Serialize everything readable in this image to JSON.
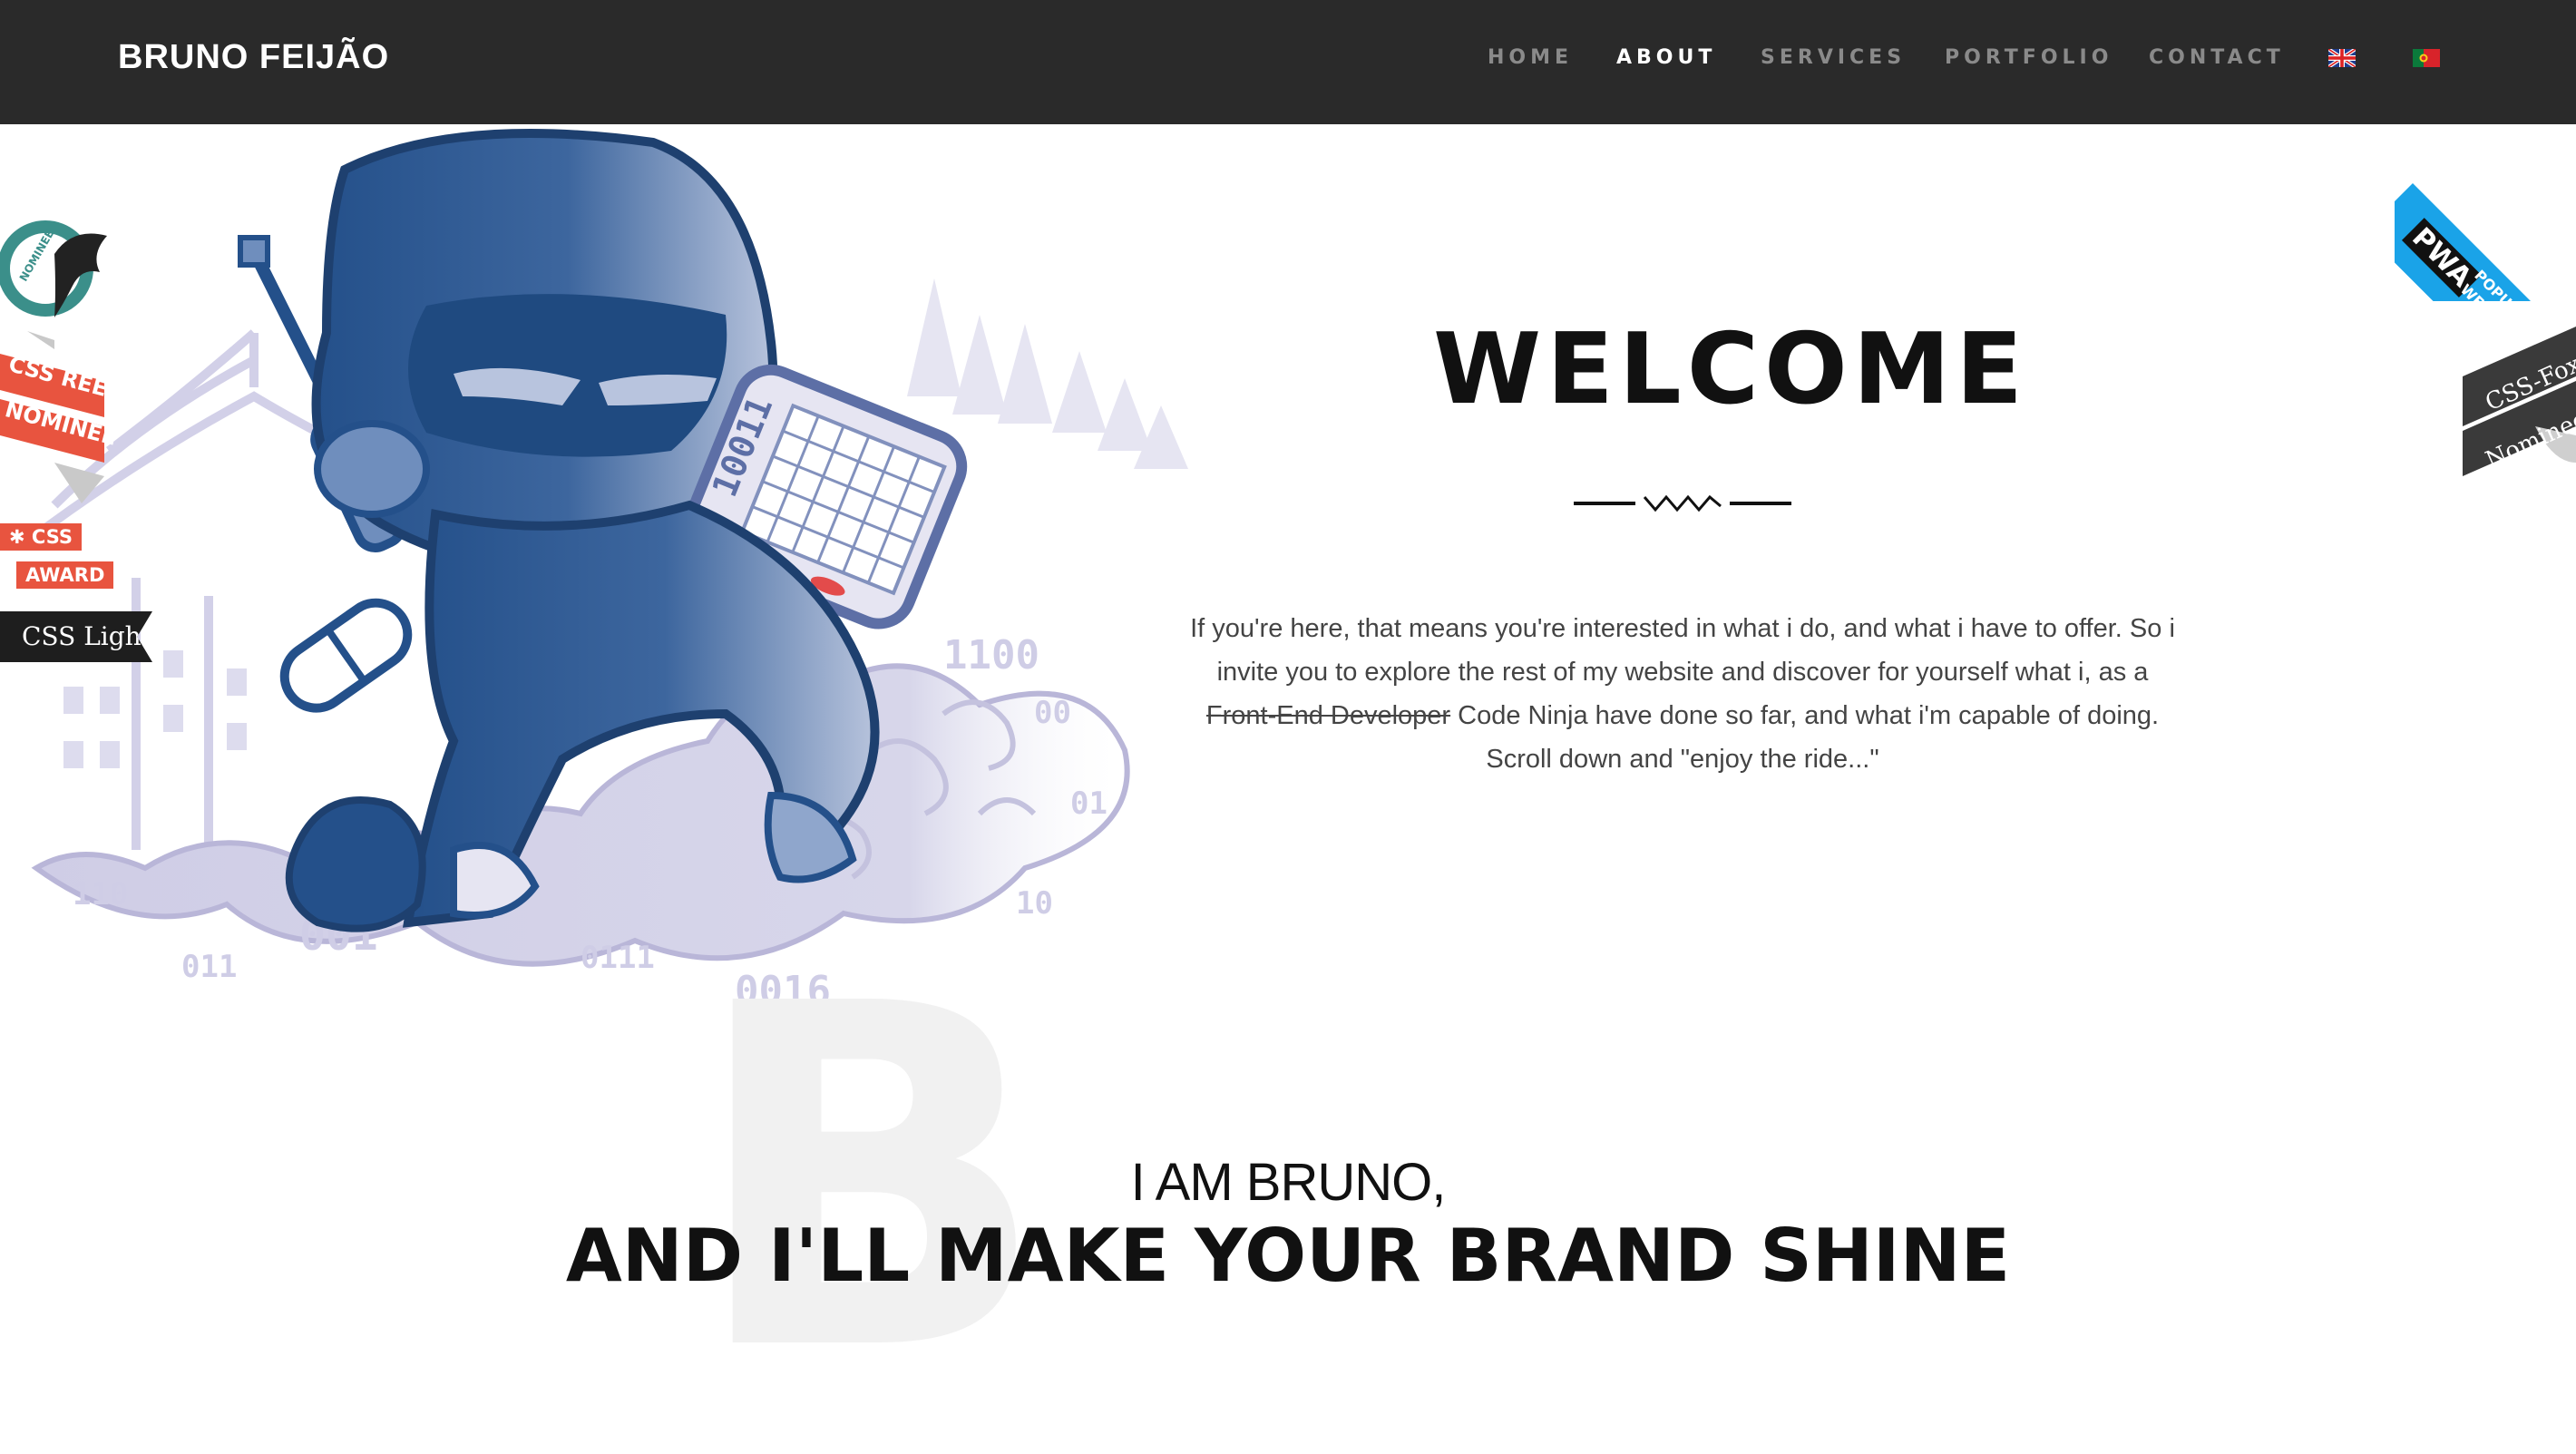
{
  "site": {
    "brand": "BRUNO FEIJÃO"
  },
  "nav": {
    "items": [
      {
        "label": "HOME",
        "active": false
      },
      {
        "label": "ABOUT",
        "active": true
      },
      {
        "label": "SERVICES",
        "active": false
      },
      {
        "label": "PORTFOLIO",
        "active": false
      },
      {
        "label": "CONTACT",
        "active": false
      }
    ],
    "flags": [
      {
        "name": "english-flag-icon"
      },
      {
        "name": "portuguese-flag-icon"
      }
    ]
  },
  "badges": {
    "nominee_label": "NOMINEE",
    "cssreel_line1": "CSS REEL",
    "cssreel_line2": "NOMINEE",
    "cssaward_line1": "CSS",
    "cssaward_line2": "AWARD",
    "csslight": "CSS Light",
    "pwa_short": "PWA",
    "pwa_line1": "POPULAR",
    "pwa_line2": "WEBSITE AWARD",
    "cssfox_line1": "CSS-Fox",
    "cssfox_line2": "Nominee"
  },
  "artwork": {
    "device_text": "10011",
    "binary_bits": [
      "110",
      "011",
      "001",
      "0111",
      "0016",
      "1100",
      "00",
      "01",
      "10"
    ]
  },
  "welcome": {
    "title": "WELCOME",
    "text_before": "If you're here, that means you're interested in what i do, and what i have to offer. So i invite you to explore the rest of my website and discover for yourself what i, as a ",
    "struck": "Front-End Developer",
    "text_after": " Code Ninja have done so far, and what i'm capable of doing. Scroll down and \"enjoy the ride...\""
  },
  "about": {
    "big_letter": "B",
    "line1": "I AM BRUNO,",
    "line2": "AND I'LL MAKE YOUR BRAND SHINE"
  },
  "colors": {
    "nav_bg": "#2a2a2a",
    "ninja_dark": "#24508a",
    "ninja_light": "#6f8ebd",
    "lilac": "#cfcde6",
    "award_red": "#e8543f",
    "pwa_blue": "#1aa3e8"
  }
}
